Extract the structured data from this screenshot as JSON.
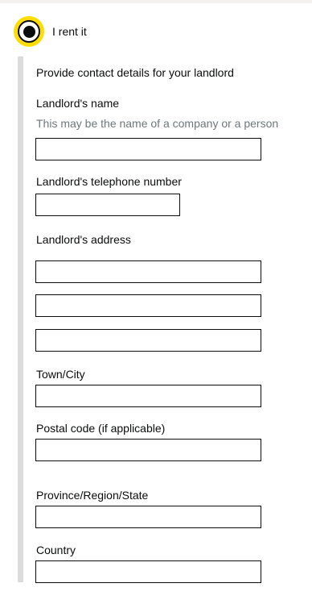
{
  "option": {
    "label": "I rent it",
    "selected": true
  },
  "landlord_section": {
    "intro": "Provide contact details for your landlord",
    "name_label": "Landlord's name",
    "name_hint": "This may be the name of a company or a person",
    "name_value": "",
    "phone_label": "Landlord's telephone number",
    "phone_value": "",
    "address_label": "Landlord's address",
    "address_line1": "",
    "address_line2": "",
    "address_line3": "",
    "town_label": "Town/City",
    "town_value": "",
    "postcode_label": "Postal code (if applicable)",
    "postcode_value": "",
    "province_label": "Province/Region/State",
    "province_value": "",
    "country_label": "Country",
    "country_value": ""
  },
  "colors": {
    "focus": "#ffdd00",
    "text": "#0b0c0c",
    "hint": "#6f777b",
    "inset_border": "#dcdcdc"
  }
}
